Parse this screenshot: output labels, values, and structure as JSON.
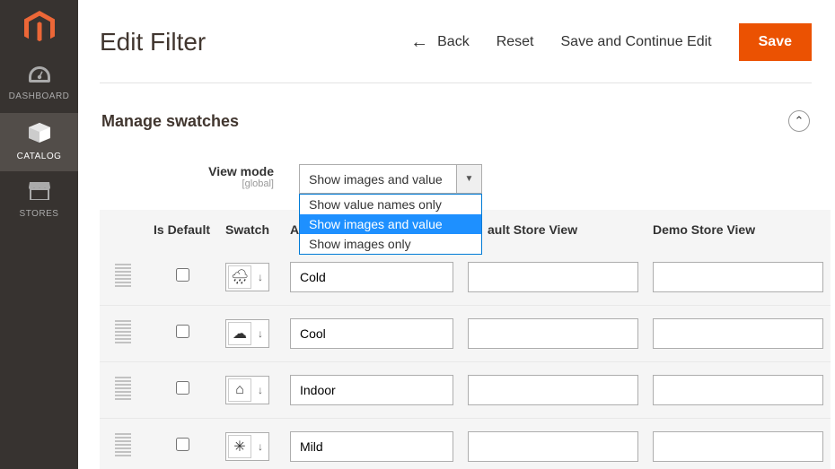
{
  "sidebar": {
    "items": [
      {
        "label": "DASHBOARD"
      },
      {
        "label": "CATALOG"
      },
      {
        "label": "STORES"
      }
    ]
  },
  "header": {
    "title": "Edit Filter",
    "back": "Back",
    "reset": "Reset",
    "save_continue": "Save and Continue Edit",
    "save": "Save"
  },
  "section": {
    "title": "Manage swatches"
  },
  "view_mode": {
    "label": "View mode",
    "scope": "[global]",
    "value": "Show images and value",
    "options": [
      "Show value names only",
      "Show images and value",
      "Show images only"
    ]
  },
  "columns": {
    "is_default": "Is Default",
    "swatch": "Swatch",
    "admin_partial": "Ad",
    "default_store_partial": "ault Store View",
    "demo_store": "Demo Store View"
  },
  "rows": [
    {
      "icon": "rain",
      "admin": "Cold",
      "default_store": "",
      "demo_store": ""
    },
    {
      "icon": "cloud",
      "admin": "Cool",
      "default_store": "",
      "demo_store": ""
    },
    {
      "icon": "house",
      "admin": "Indoor",
      "default_store": "",
      "demo_store": ""
    },
    {
      "icon": "sun",
      "admin": "Mild",
      "default_store": "",
      "demo_store": ""
    }
  ]
}
